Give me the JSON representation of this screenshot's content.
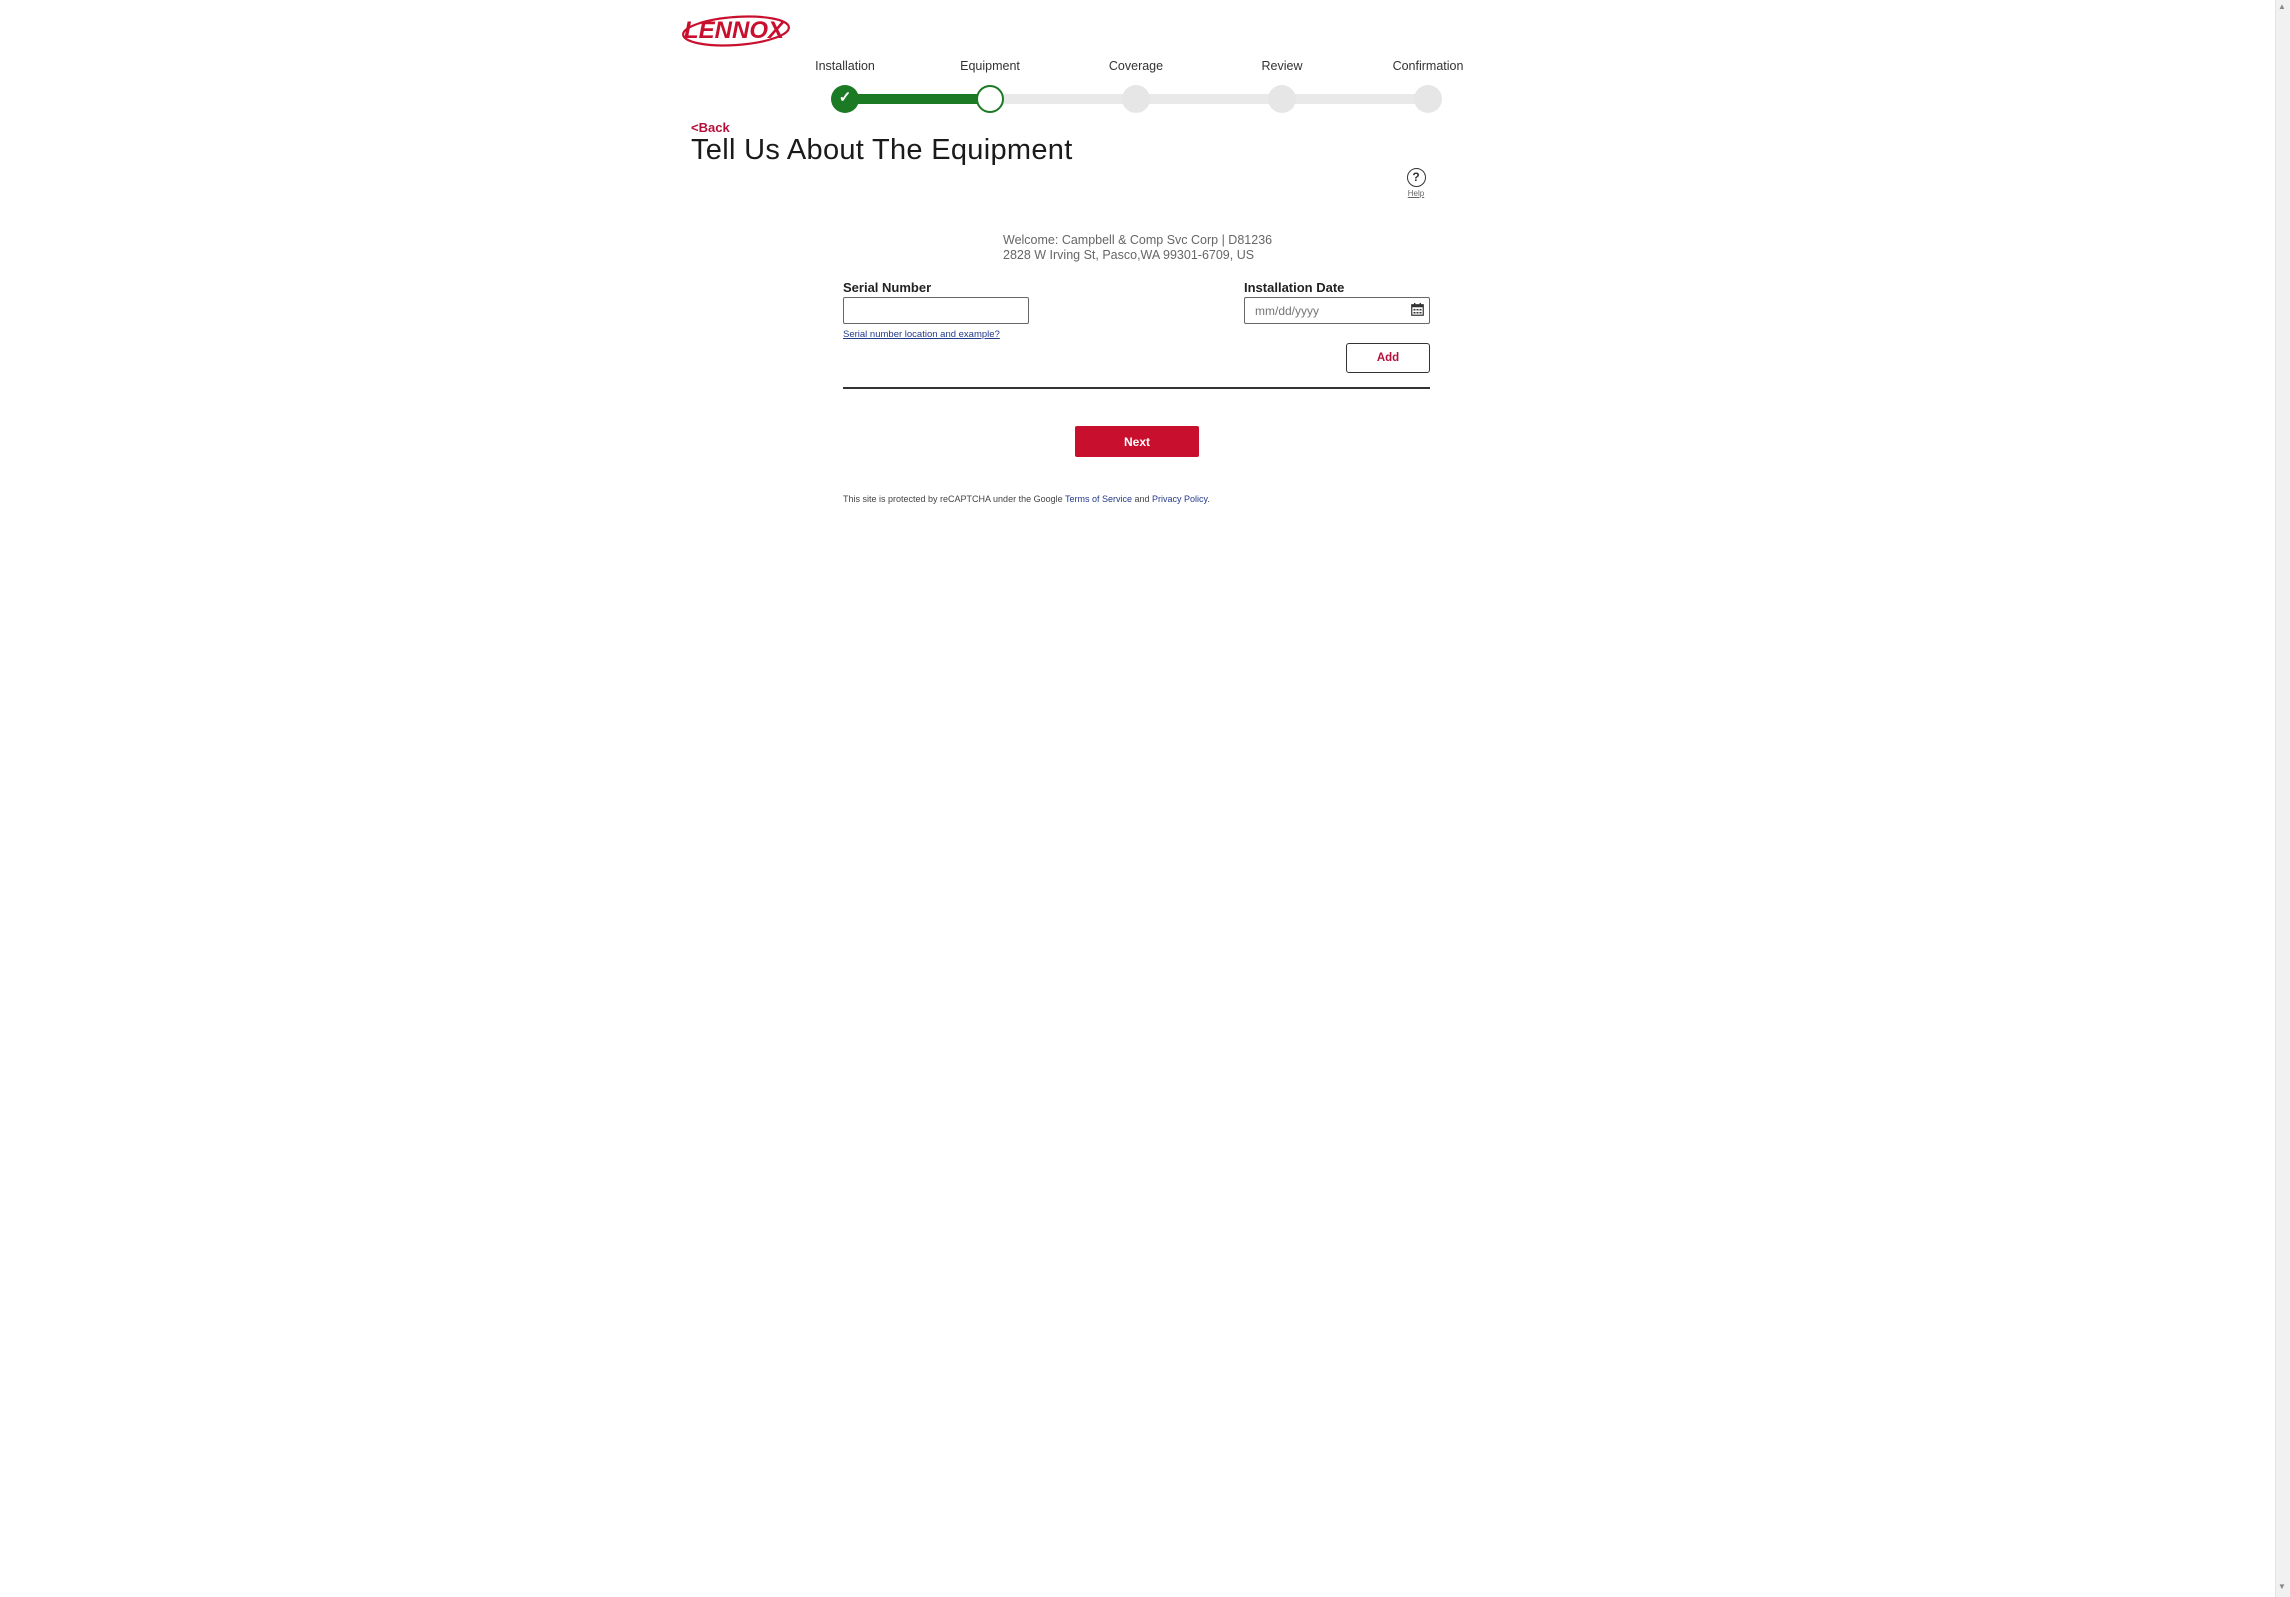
{
  "brand": {
    "logo_text": "LENNOX",
    "primary_color": "#c8102e",
    "progress_color": "#1b7a23",
    "link_color": "#243a8a"
  },
  "progress": {
    "steps": [
      {
        "label": "Installation",
        "state": "complete"
      },
      {
        "label": "Equipment",
        "state": "current"
      },
      {
        "label": "Coverage",
        "state": "upcoming"
      },
      {
        "label": "Review",
        "state": "upcoming"
      },
      {
        "label": "Confirmation",
        "state": "upcoming"
      }
    ],
    "completed_fraction": 0.25
  },
  "header": {
    "back_label": "<Back",
    "title": "Tell Us About The Equipment",
    "help_label": "Help",
    "help_icon": "question-circle-icon"
  },
  "welcome": {
    "line1": "Welcome: Campbell & Comp Svc Corp | D81236",
    "line2": "2828 W Irving St, Pasco,WA 99301-6709, US"
  },
  "form": {
    "serial_label": "Serial Number",
    "serial_value": "",
    "serial_help_link": "Serial number location and example?",
    "date_label": "Installation Date",
    "date_placeholder": "mm/dd/yyyy",
    "date_icon": "calendar-icon",
    "add_label": "Add",
    "next_label": "Next"
  },
  "footer": {
    "recaptcha_prefix": "This site is protected by reCAPTCHA under the Google ",
    "terms_link": "Terms of Service",
    "and_text": " and ",
    "privacy_link": "Privacy Policy",
    "suffix": "."
  }
}
